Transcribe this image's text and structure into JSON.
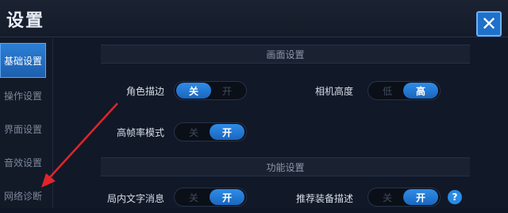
{
  "title": "设置",
  "close_icon": "close-x-icon",
  "sidebar": {
    "items": [
      {
        "label": "基础设置",
        "active": true
      },
      {
        "label": "操作设置",
        "active": false
      },
      {
        "label": "界面设置",
        "active": false
      },
      {
        "label": "音效设置",
        "active": false
      },
      {
        "label": "网络诊断",
        "active": false
      }
    ]
  },
  "sections": {
    "display": "画面设置",
    "function": "功能设置"
  },
  "settings": {
    "outline": {
      "label": "角色描边",
      "left": "关",
      "right": "开",
      "selected": "关"
    },
    "camera": {
      "label": "相机高度",
      "left": "低",
      "right": "高",
      "selected": "高"
    },
    "hfr": {
      "label": "高帧率模式",
      "left": "关",
      "right": "开",
      "selected": "开"
    },
    "ingame_text": {
      "label": "局内文字消息",
      "left": "关",
      "right": "开",
      "selected": "开"
    },
    "recommend_gear": {
      "label": "推荐装备描述",
      "left": "关",
      "right": "开",
      "selected": "开"
    }
  },
  "help_icon_text": "?",
  "colors": {
    "accent": "#2a86e0",
    "arrow": "#e0252b"
  }
}
